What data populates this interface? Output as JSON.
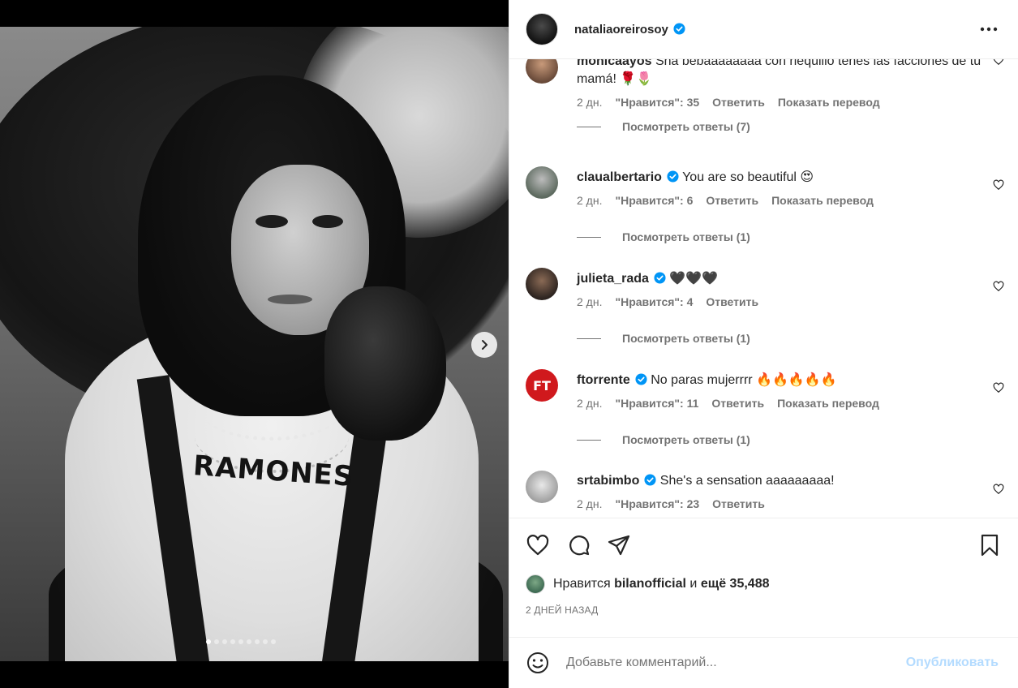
{
  "post": {
    "author": "nataliaoreirosoy",
    "shirt_text": "RAMONES"
  },
  "carousel": {
    "dot_count": 9,
    "active_index": 0
  },
  "comments": [
    {
      "username": "monicaayos",
      "text": "Sha bebaaaaaaaa con riequilio tenés las facciones de tu mamá!",
      "emoji": "🌹🌷",
      "time": "2 дн.",
      "likes": "\"Нравится\": 35",
      "reply": "Ответить",
      "translate": "Показать перевод",
      "replies": "Посмотреть ответы (7)"
    },
    {
      "username": "claualbertario",
      "text": "You are so beautiful",
      "emoji": "😍 ",
      "time": "2 дн.",
      "likes": "\"Нравится\": 6",
      "reply": "Ответить",
      "translate": "Показать перевод",
      "replies": "Посмотреть ответы (1)"
    },
    {
      "username": "julieta_rada",
      "text": "",
      "emoji": "🖤🖤🖤",
      "time": "2 дн.",
      "likes": "\"Нравится\": 4",
      "reply": "Ответить",
      "replies": "Посмотреть ответы (1)"
    },
    {
      "username": "ftorrente",
      "avatar_initials": "FT",
      "text": "No paras mujerrrr",
      "emoji": "🔥🔥🔥🔥🔥",
      "time": "2 дн.",
      "likes": "\"Нравится\": 11",
      "reply": "Ответить",
      "translate": "Показать перевод",
      "replies": "Посмотреть ответы (1)"
    },
    {
      "username": "srtabimbo",
      "text": "She's a sensation aaaaaaaaa!",
      "emoji": "",
      "time": "2 дн.",
      "likes": "\"Нравится\": 23",
      "reply": "Ответить"
    }
  ],
  "likes_line": {
    "prefix": "Нравится",
    "user": "bilanofficial",
    "middle": "и",
    "rest": "ещё 35,488"
  },
  "date": "2 ДНЕЙ НАЗАД",
  "compose": {
    "placeholder": "Добавьте комментарий...",
    "post_label": "Опубликовать"
  },
  "colors": {
    "verified": "#0095f6",
    "meta_text": "#737373",
    "post_disabled": "#b3dbff",
    "ft_avatar": "#d0191d"
  },
  "icons": [
    "more-icon",
    "heart-icon",
    "comment-icon",
    "share-icon",
    "bookmark-icon",
    "emoji-icon",
    "chevron-right-icon",
    "verified-icon"
  ]
}
